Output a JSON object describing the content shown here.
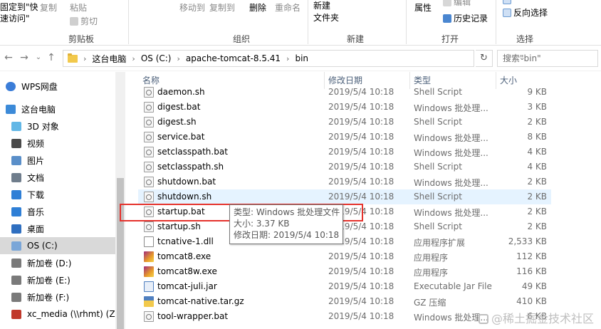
{
  "ribbon": {
    "pin_quick": "固定到\"快\n速访问\"",
    "copy": "复制",
    "paste": "粘贴",
    "cut": "剪切",
    "group_clipboard": "剪贴板",
    "move_to": "移动到",
    "copy_to": "复制到",
    "delete": "删除",
    "rename": "重命名",
    "group_organize": "组织",
    "new_folder": "新建\n文件夹",
    "group_new": "新建",
    "properties": "属性",
    "edit": "编辑",
    "history": "历史记录",
    "group_open": "打开",
    "invert_selection": "反向选择",
    "group_select": "选择"
  },
  "address": {
    "crumbs": [
      "这台电脑",
      "OS (C:)",
      "apache-tomcat-8.5.41",
      "bin"
    ],
    "search_placeholder": "搜索\"bin\""
  },
  "nav": {
    "items": [
      {
        "label": "WPS网盘",
        "icon": "cloud-icon",
        "color": "#3b7dd8"
      },
      {
        "label": "这台电脑",
        "icon": "computer-icon",
        "color": "#3c8ad8"
      },
      {
        "label": "3D 对象",
        "icon": "cube-icon",
        "color": "#62b7e6"
      },
      {
        "label": "视频",
        "icon": "video-icon",
        "color": "#4a4a4a"
      },
      {
        "label": "图片",
        "icon": "picture-icon",
        "color": "#5a8fc9"
      },
      {
        "label": "文档",
        "icon": "document-icon",
        "color": "#6f7d8c"
      },
      {
        "label": "下载",
        "icon": "download-icon",
        "color": "#2f7fd6"
      },
      {
        "label": "音乐",
        "icon": "music-icon",
        "color": "#2f7fd6"
      },
      {
        "label": "桌面",
        "icon": "desktop-icon",
        "color": "#2f6fc0"
      },
      {
        "label": "OS (C:)",
        "icon": "drive-icon",
        "color": "#7aa6d8"
      },
      {
        "label": "新加卷 (D:)",
        "icon": "drive-icon",
        "color": "#7a7a7a"
      },
      {
        "label": "新加卷 (E:)",
        "icon": "drive-icon",
        "color": "#7a7a7a"
      },
      {
        "label": "新加卷 (F:)",
        "icon": "drive-icon",
        "color": "#7a7a7a"
      },
      {
        "label": "xc_media (\\\\rhmt) (Z:)",
        "icon": "network-drive-icon",
        "color": "#c0392b"
      }
    ]
  },
  "columns": {
    "name": "名称",
    "date": "修改日期",
    "type": "类型",
    "size": "大小"
  },
  "files": [
    {
      "name": "daemon.sh",
      "date": "2019/5/4 10:18",
      "type": "Shell Script",
      "size": "9 KB",
      "icon": "gear"
    },
    {
      "name": "digest.bat",
      "date": "2019/5/4 10:18",
      "type": "Windows 批处理...",
      "size": "3 KB",
      "icon": "gear"
    },
    {
      "name": "digest.sh",
      "date": "2019/5/4 10:18",
      "type": "Shell Script",
      "size": "2 KB",
      "icon": "gear"
    },
    {
      "name": "service.bat",
      "date": "2019/5/4 10:18",
      "type": "Windows 批处理...",
      "size": "8 KB",
      "icon": "gear"
    },
    {
      "name": "setclasspath.bat",
      "date": "2019/5/4 10:18",
      "type": "Windows 批处理...",
      "size": "4 KB",
      "icon": "gear"
    },
    {
      "name": "setclasspath.sh",
      "date": "2019/5/4 10:18",
      "type": "Shell Script",
      "size": "4 KB",
      "icon": "gear"
    },
    {
      "name": "shutdown.bat",
      "date": "2019/5/4 10:18",
      "type": "Windows 批处理...",
      "size": "2 KB",
      "icon": "gear"
    },
    {
      "name": "shutdown.sh",
      "date": "2019/5/4 10:18",
      "type": "Shell Script",
      "size": "2 KB",
      "icon": "gear"
    },
    {
      "name": "startup.bat",
      "date": "2019/5/4 10:18",
      "type": "Windows 批处理...",
      "size": "2 KB",
      "icon": "gear"
    },
    {
      "name": "startup.sh",
      "date": "2019/5/4 10:18",
      "type": "Shell Script",
      "size": "2 KB",
      "icon": "gear"
    },
    {
      "name": "tcnative-1.dll",
      "date": "2019/5/4 10:18",
      "type": "应用程序扩展",
      "size": "2,533 KB",
      "icon": "dll"
    },
    {
      "name": "tomcat8.exe",
      "date": "2019/5/4 10:18",
      "type": "应用程序",
      "size": "112 KB",
      "icon": "exe"
    },
    {
      "name": "tomcat8w.exe",
      "date": "2019/5/4 10:18",
      "type": "应用程序",
      "size": "116 KB",
      "icon": "exe"
    },
    {
      "name": "tomcat-juli.jar",
      "date": "2019/5/4 10:18",
      "type": "Executable Jar File",
      "size": "49 KB",
      "icon": "jar"
    },
    {
      "name": "tomcat-native.tar.gz",
      "date": "2019/5/4 10:18",
      "type": "GZ 压缩",
      "size": "410 KB",
      "icon": "zip"
    },
    {
      "name": "tool-wrapper.bat",
      "date": "2019/5/4 10:18",
      "type": "Windows 批处理...",
      "size": "6 KB",
      "icon": "gear"
    }
  ],
  "tooltip": {
    "type_line": "类型: Windows 批处理文件",
    "size_line": "大小: 3.37 KB",
    "date_line": "修改日期: 2019/5/4 10:18"
  },
  "watermark": "@稀土掘金技术社区"
}
